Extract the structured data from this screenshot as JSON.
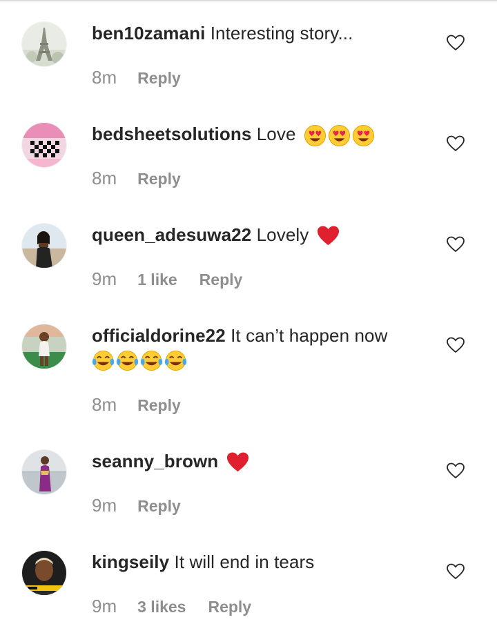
{
  "colors": {
    "text": "#262626",
    "muted": "#8e8e8e",
    "heart_red": "#e0202e",
    "divider": "#dbdbdb"
  },
  "comments": [
    {
      "username": "ben10zamani",
      "text": "Interesting story...",
      "emojis": [],
      "time": "8m",
      "likes": "",
      "reply_label": "Reply",
      "avatar_icon": "avatar-eiffel-tower"
    },
    {
      "username": "bedsheetsolutions",
      "text": "Love",
      "emojis": [
        "heart-eyes-emoji",
        "heart-eyes-emoji",
        "heart-eyes-emoji"
      ],
      "time": "8m",
      "likes": "",
      "reply_label": "Reply",
      "avatar_icon": "avatar-bedsheet"
    },
    {
      "username": "queen_adesuwa22",
      "text": "Lovely",
      "emojis": [
        "red-heart-emoji"
      ],
      "time": "9m",
      "likes": "1 like",
      "reply_label": "Reply",
      "avatar_icon": "avatar-woman-outdoor"
    },
    {
      "username": "officialdorine22",
      "text": "It can’t happen now",
      "emojis": [
        "tears-of-joy-emoji",
        "tears-of-joy-emoji",
        "tears-of-joy-emoji",
        "tears-of-joy-emoji"
      ],
      "time": "8m",
      "likes": "",
      "reply_label": "Reply",
      "avatar_icon": "avatar-woman-poolside"
    },
    {
      "username": "seanny_brown",
      "text": "",
      "emojis": [
        "red-heart-emoji"
      ],
      "time": "9m",
      "likes": "",
      "reply_label": "Reply",
      "avatar_icon": "avatar-woman-purple-dress"
    },
    {
      "username": "kingseily",
      "text": "It will end in tears",
      "emojis": [],
      "time": "9m",
      "likes": "3 likes",
      "reply_label": "Reply",
      "avatar_icon": "avatar-man-portrait"
    }
  ]
}
